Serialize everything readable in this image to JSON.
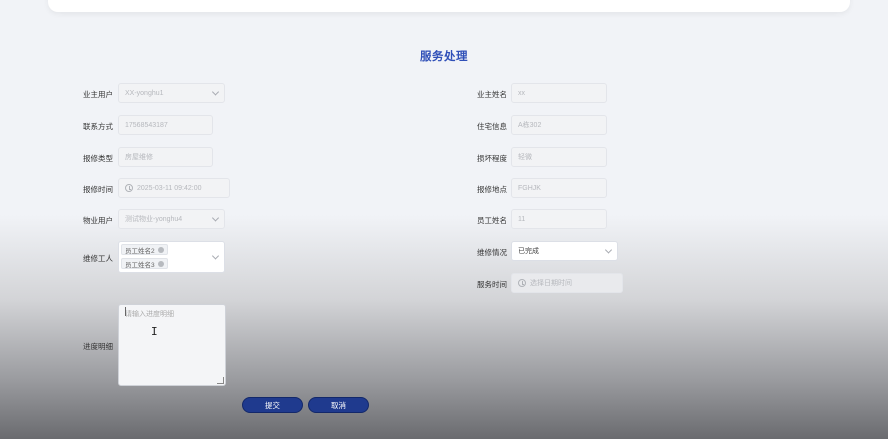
{
  "page": {
    "title": "服务处理"
  },
  "left": {
    "owner_user": {
      "label": "业主用户",
      "value": "XX-yonghu1"
    },
    "contact": {
      "label": "联系方式",
      "value": "17568543187"
    },
    "repair_type": {
      "label": "报修类型",
      "value": "房屋维修"
    },
    "repair_time": {
      "label": "报修时间",
      "value": "2025-03-11 09:42:00"
    },
    "property_user": {
      "label": "物业用户",
      "value": "测试物业-yonghu4"
    },
    "workers": {
      "label": "维修工人",
      "tags": [
        "员工姓名2",
        "员工姓名3"
      ]
    },
    "progress": {
      "label": "进度明细",
      "placeholder": "请输入进度明细"
    }
  },
  "right": {
    "owner_name": {
      "label": "业主姓名",
      "value": "xx"
    },
    "residence": {
      "label": "住宅信息",
      "value": "A栋302"
    },
    "damage_level": {
      "label": "损坏程度",
      "value": "轻微"
    },
    "repair_location": {
      "label": "报修地点",
      "value": "FGHJK"
    },
    "staff_name": {
      "label": "员工姓名",
      "value": "11"
    },
    "repair_status": {
      "label": "维修情况",
      "value": "已完成"
    },
    "service_time": {
      "label": "服务时间",
      "placeholder": "选择日期时间"
    }
  },
  "actions": {
    "submit": "提交",
    "cancel": "取消"
  }
}
